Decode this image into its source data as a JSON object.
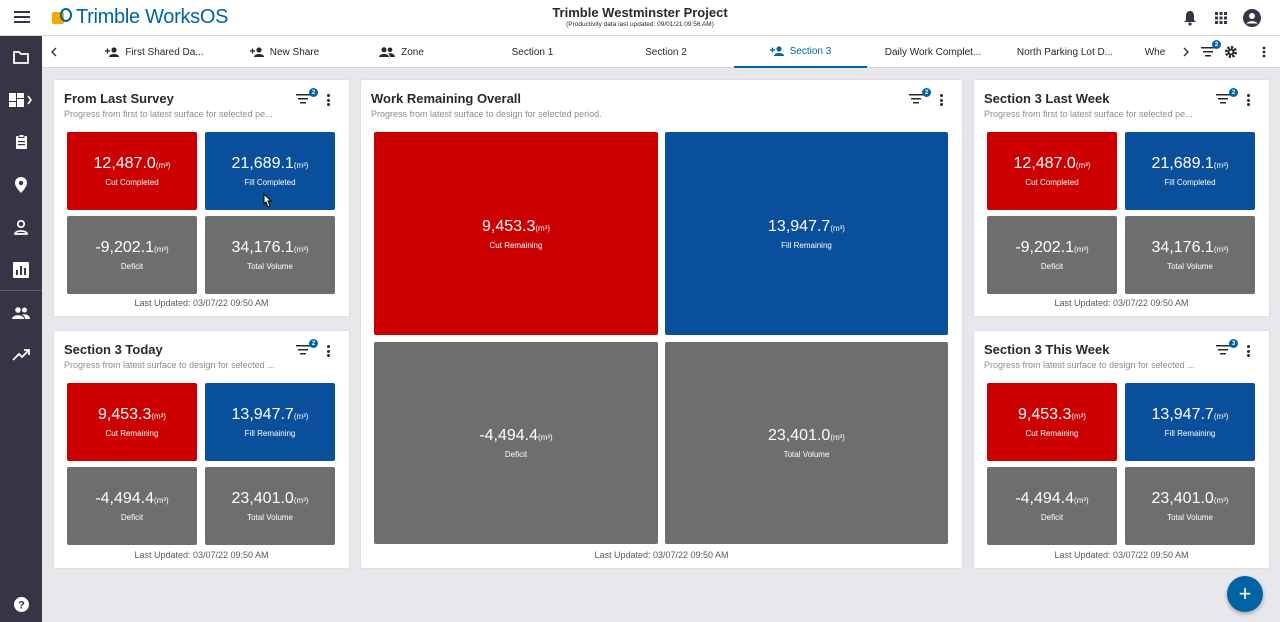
{
  "app": {
    "logo_text": "Trimble WorksOS",
    "project_title": "Trimble Westminster Project",
    "project_subtitle": "(Productivity data last updated: 09/01/21 09:56 AM)"
  },
  "topbar_icons": [
    "bell-icon",
    "apps-grid-icon",
    "account-icon"
  ],
  "leftnav": [
    "folder-icon",
    "dashboard-icon",
    "clipboard-icon",
    "location-pin-icon",
    "user-icon",
    "reports-icon",
    "team-icon",
    "trending-icon",
    "help-icon"
  ],
  "tabs": [
    {
      "label": "First Shared Da...",
      "icon": "person-add-icon"
    },
    {
      "label": "New Share",
      "icon": "person-add-icon"
    },
    {
      "label": "Zone",
      "icon": "group-icon"
    },
    {
      "label": "Section 1",
      "icon": ""
    },
    {
      "label": "Section 2",
      "icon": ""
    },
    {
      "label": "Section 3",
      "icon": "person-add-icon",
      "active": true
    },
    {
      "label": "Daily Work Complet...",
      "icon": ""
    },
    {
      "label": "North Parking Lot D...",
      "icon": ""
    },
    {
      "label": "Whe",
      "icon": ""
    }
  ],
  "tabbar_filter_badge": "2",
  "cards": {
    "from_last_survey": {
      "title": "From Last Survey",
      "subtitle": "Progress from first to latest surface for selected pe...",
      "filter_badge": "2",
      "tiles": [
        {
          "value": "12,487.0",
          "unit": "(m³)",
          "label": "Cut Completed",
          "color": "red"
        },
        {
          "value": "21,689.1",
          "unit": "(m³)",
          "label": "Fill Completed",
          "color": "blue"
        },
        {
          "value": "-9,202.1",
          "unit": "(m³)",
          "label": "Deficit",
          "color": "grey"
        },
        {
          "value": "34,176.1",
          "unit": "(m³)",
          "label": "Total Volume",
          "color": "grey"
        }
      ],
      "updated": "Last Updated: 03/07/22 09:50 AM"
    },
    "section3_today": {
      "title": "Section 3 Today",
      "subtitle": "Progress from latest surface to design for selected ...",
      "filter_badge": "2",
      "tiles": [
        {
          "value": "9,453.3",
          "unit": "(m³)",
          "label": "Cut Remaining",
          "color": "red"
        },
        {
          "value": "13,947.7",
          "unit": "(m³)",
          "label": "Fill Remaining",
          "color": "blue"
        },
        {
          "value": "-4,494.4",
          "unit": "(m³)",
          "label": "Deficit",
          "color": "grey"
        },
        {
          "value": "23,401.0",
          "unit": "(m³)",
          "label": "Total Volume",
          "color": "grey"
        }
      ],
      "updated": "Last Updated: 03/07/22 09:50 AM"
    },
    "work_remaining": {
      "title": "Work Remaining Overall",
      "subtitle": "Progress from latest surface to design for selected period.",
      "filter_badge": "2",
      "tiles": [
        {
          "value": "9,453.3",
          "unit": "(m³)",
          "label": "Cut Remaining",
          "color": "red"
        },
        {
          "value": "13,947.7",
          "unit": "(m³)",
          "label": "Fill Remaining",
          "color": "blue"
        },
        {
          "value": "-4,494.4",
          "unit": "(m³)",
          "label": "Deficit",
          "color": "grey"
        },
        {
          "value": "23,401.0",
          "unit": "(m³)",
          "label": "Total Volume",
          "color": "grey"
        }
      ],
      "updated": "Last Updated: 03/07/22 09:50 AM"
    },
    "section3_last_week": {
      "title": "Section 3 Last Week",
      "subtitle": "Progress from first to latest surface for selected pe...",
      "filter_badge": "2",
      "tiles": [
        {
          "value": "12,487.0",
          "unit": "(m³)",
          "label": "Cut Completed",
          "color": "red"
        },
        {
          "value": "21,689.1",
          "unit": "(m³)",
          "label": "Fill Completed",
          "color": "blue"
        },
        {
          "value": "-9,202.1",
          "unit": "(m³)",
          "label": "Deficit",
          "color": "grey"
        },
        {
          "value": "34,176.1",
          "unit": "(m³)",
          "label": "Total Volume",
          "color": "grey"
        }
      ],
      "updated": "Last Updated: 03/07/22 09:50 AM"
    },
    "section3_this_week": {
      "title": "Section 3 This Week",
      "subtitle": "Progress from latest surface to design for selected ...",
      "filter_badge": "3",
      "tiles": [
        {
          "value": "9,453.3",
          "unit": "(m³)",
          "label": "Cut Remaining",
          "color": "red"
        },
        {
          "value": "13,947.7",
          "unit": "(m³)",
          "label": "Fill Remaining",
          "color": "blue"
        },
        {
          "value": "-4,494.4",
          "unit": "(m³)",
          "label": "Deficit",
          "color": "grey"
        },
        {
          "value": "23,401.0",
          "unit": "(m³)",
          "label": "Total Volume",
          "color": "grey"
        }
      ],
      "updated": "Last Updated: 03/07/22 09:50 AM"
    }
  },
  "colors": {
    "brand": "#0063a3",
    "cut": "#cc0000",
    "fill": "#0a4f9b",
    "neutral": "#6e6e6e",
    "nav": "#363545"
  },
  "fab_label": "+"
}
